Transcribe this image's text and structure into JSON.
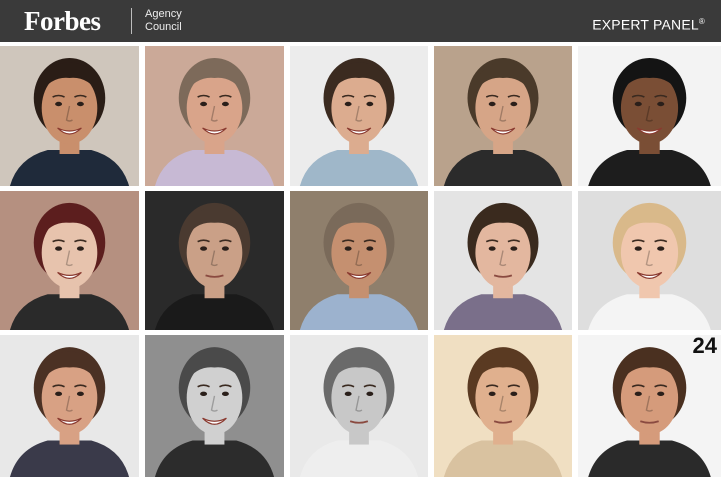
{
  "header": {
    "logo": "Forbes",
    "council_line1": "Agency",
    "council_line2": "Council",
    "panel": "EXPERT PANEL",
    "panel_mark": "®"
  },
  "colors": {
    "header_bg": "#3a3a3a",
    "header_text": "#ffffff"
  },
  "portraits": [
    {
      "bg": "#cfc6bc",
      "skin": "#c98f6c",
      "hair": "#2a1d16",
      "shirt": "#1f2a3a",
      "mood": "smile"
    },
    {
      "bg": "#cba998",
      "skin": "#d9a48a",
      "hair": "#7d6a5a",
      "shirt": "#c7b9d4",
      "mood": "smile"
    },
    {
      "bg": "#ececec",
      "skin": "#dcac8f",
      "hair": "#3b2b20",
      "shirt": "#9fb7c9",
      "mood": "smile"
    },
    {
      "bg": "#b9a28c",
      "skin": "#d6a587",
      "hair": "#4a3a2a",
      "shirt": "#2b2b2b",
      "mood": "smile"
    },
    {
      "bg": "#f3f3f3",
      "skin": "#7a4e35",
      "hair": "#141414",
      "shirt": "#1d1d1d",
      "mood": "smile"
    },
    {
      "bg": "#b59080",
      "skin": "#e7c3ad",
      "hair": "#5c1e1e",
      "shirt": "#2a2a2a",
      "mood": "smile"
    },
    {
      "bg": "#2a2a2a",
      "skin": "#caa087",
      "hair": "#4a3a30",
      "shirt": "#1a1a1a",
      "mood": "neutral"
    },
    {
      "bg": "#8f7f6c",
      "skin": "#c59070",
      "hair": "#7a6a5a",
      "shirt": "#9cb2ce",
      "mood": "smile"
    },
    {
      "bg": "#e4e4e4",
      "skin": "#e3b79f",
      "hair": "#3a2a1e",
      "shirt": "#7a6f8a",
      "mood": "neutral"
    },
    {
      "bg": "#dedede",
      "skin": "#f0c7ae",
      "hair": "#d9b98a",
      "shirt": "#f4f4f4",
      "mood": "smile"
    },
    {
      "bg": "#e8e8e8",
      "skin": "#d8a184",
      "hair": "#4b3124",
      "shirt": "#3a3a4a",
      "mood": "smile"
    },
    {
      "bg": "#8f8f8f",
      "skin": "#d0d0d0",
      "hair": "#4a4a4a",
      "shirt": "#2c2c2c",
      "mood": "smile"
    },
    {
      "bg": "#e9e9e9",
      "skin": "#c8c8c8",
      "hair": "#6a6a6a",
      "shirt": "#eeeeee",
      "mood": "neutral"
    },
    {
      "bg": "#f0dfc2",
      "skin": "#e0b08e",
      "hair": "#5a3a22",
      "shirt": "#d9c2a0",
      "mood": "neutral"
    },
    {
      "bg": "#f4f4f4",
      "skin": "#d59b7b",
      "hair": "#4a3020",
      "shirt": "#2a2a2a",
      "mood": "neutral"
    }
  ],
  "badge_text": "24"
}
